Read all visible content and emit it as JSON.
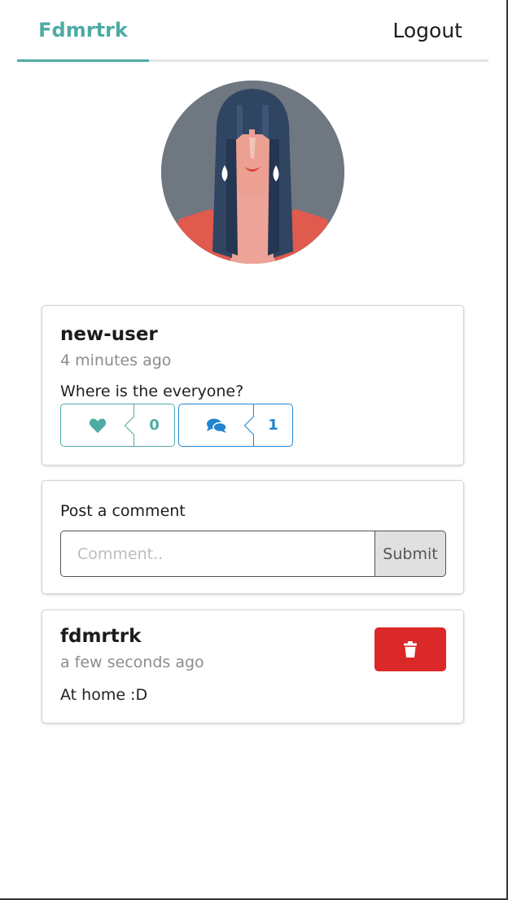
{
  "menu": {
    "home_label": "Fdmrtrk",
    "logout_label": "Logout"
  },
  "avatar": {
    "icon": "avatar-woman-icon"
  },
  "post": {
    "username": "new-user",
    "time": "4 minutes ago",
    "body": "Where is the everyone?",
    "likes": {
      "icon": "heart-icon",
      "count": "0"
    },
    "comments": {
      "icon": "comments-icon",
      "count": "1"
    }
  },
  "comment_form": {
    "label": "Post a comment",
    "placeholder": "Comment..",
    "value": "",
    "submit_label": "Submit"
  },
  "comments": [
    {
      "username": "fdmrtrk",
      "time": "a few seconds ago",
      "body": "At home :D",
      "delete_icon": "trash-icon"
    }
  ],
  "colors": {
    "teal": "#4eaba3",
    "blue": "#2185d0",
    "red": "#db2828"
  }
}
